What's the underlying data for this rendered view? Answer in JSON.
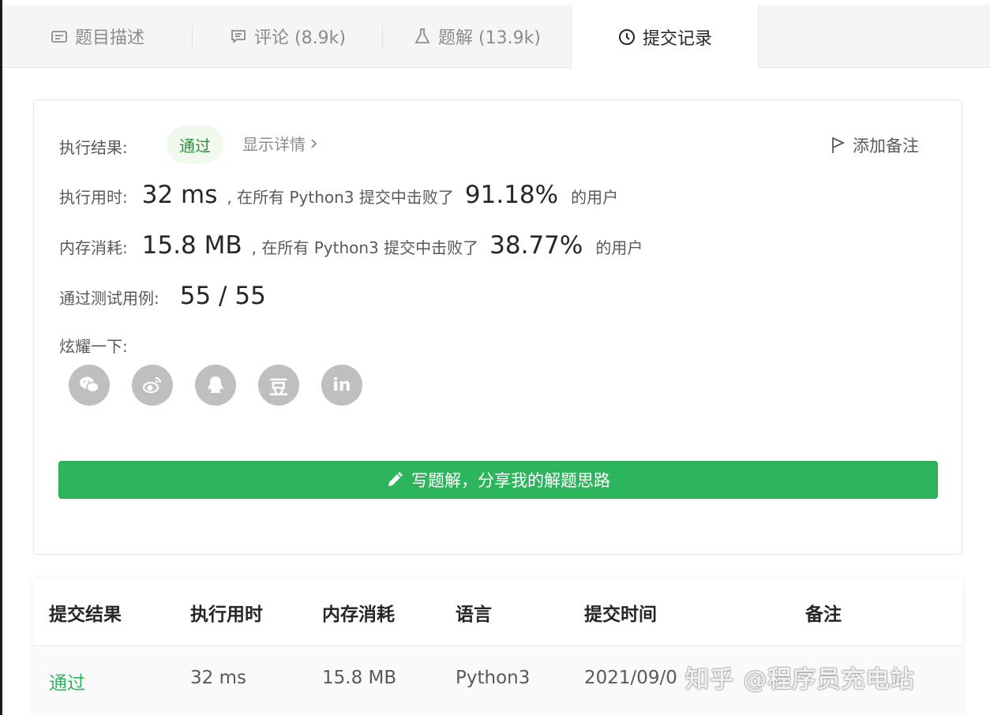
{
  "tabs": [
    {
      "label": "题目描述",
      "icon": "description-icon"
    },
    {
      "label": "评论 (8.9k)",
      "icon": "comment-icon"
    },
    {
      "label": "题解 (13.9k)",
      "icon": "flask-icon"
    },
    {
      "label": "提交记录",
      "icon": "clock-icon",
      "active": true
    }
  ],
  "result": {
    "status_label": "执行结果:",
    "status_value": "通过",
    "details_link": "显示详情",
    "add_note": "添加备注",
    "runtime_label": "执行用时:",
    "runtime_value": "32 ms",
    "runtime_mid": ", 在所有 Python3 提交中击败了",
    "runtime_pct": "91.18%",
    "runtime_tail": "的用户",
    "memory_label": "内存消耗:",
    "memory_value": "15.8 MB",
    "memory_mid": ", 在所有 Python3 提交中击败了",
    "memory_pct": "38.77%",
    "memory_tail": "的用户",
    "tests_label": "通过测试用例:",
    "tests_value": "55 / 55",
    "share_label": "炫耀一下:",
    "share_icons": [
      "wechat-icon",
      "weibo-icon",
      "qq-icon",
      "douban-icon",
      "linkedin-icon"
    ],
    "douban_glyph": "豆",
    "linkedin_glyph": "in",
    "write_button": "写题解，分享我的解题思路"
  },
  "table": {
    "headers": [
      "提交结果",
      "执行用时",
      "内存消耗",
      "语言",
      "提交时间",
      "备注"
    ],
    "rows": [
      [
        "通过",
        "32 ms",
        "15.8 MB",
        "Python3",
        "2021/09/0",
        ""
      ]
    ]
  },
  "watermark": "知乎 @程序员充电站",
  "colors": {
    "accent_green": "#2db55d",
    "pass_text": "#2d8d3f"
  }
}
